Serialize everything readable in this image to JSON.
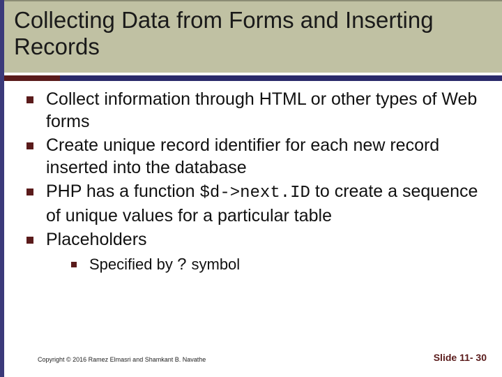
{
  "title": "Collecting Data from Forms and Inserting Records",
  "bullets": [
    {
      "text": "Collect information through HTML or other types of Web forms"
    },
    {
      "text": "Create unique record identifier for each new record inserted into the database"
    },
    {
      "prefix": "PHP has a function ",
      "code": "$d->next.ID",
      "suffix": " to create a sequence of unique values for a particular table"
    },
    {
      "text": "Placeholders",
      "sub": [
        {
          "prefix": "Specified by ",
          "code": "?",
          "suffix": " symbol"
        }
      ]
    }
  ],
  "footer": {
    "copyright": "Copyright © 2016 Ramez Elmasri and Shamkant B. Navathe",
    "slide_label": "Slide 11- 30"
  },
  "colors": {
    "title_bg": "#c0c1a3",
    "bullet": "#5a1b1b",
    "side": "#3b3a7a"
  }
}
